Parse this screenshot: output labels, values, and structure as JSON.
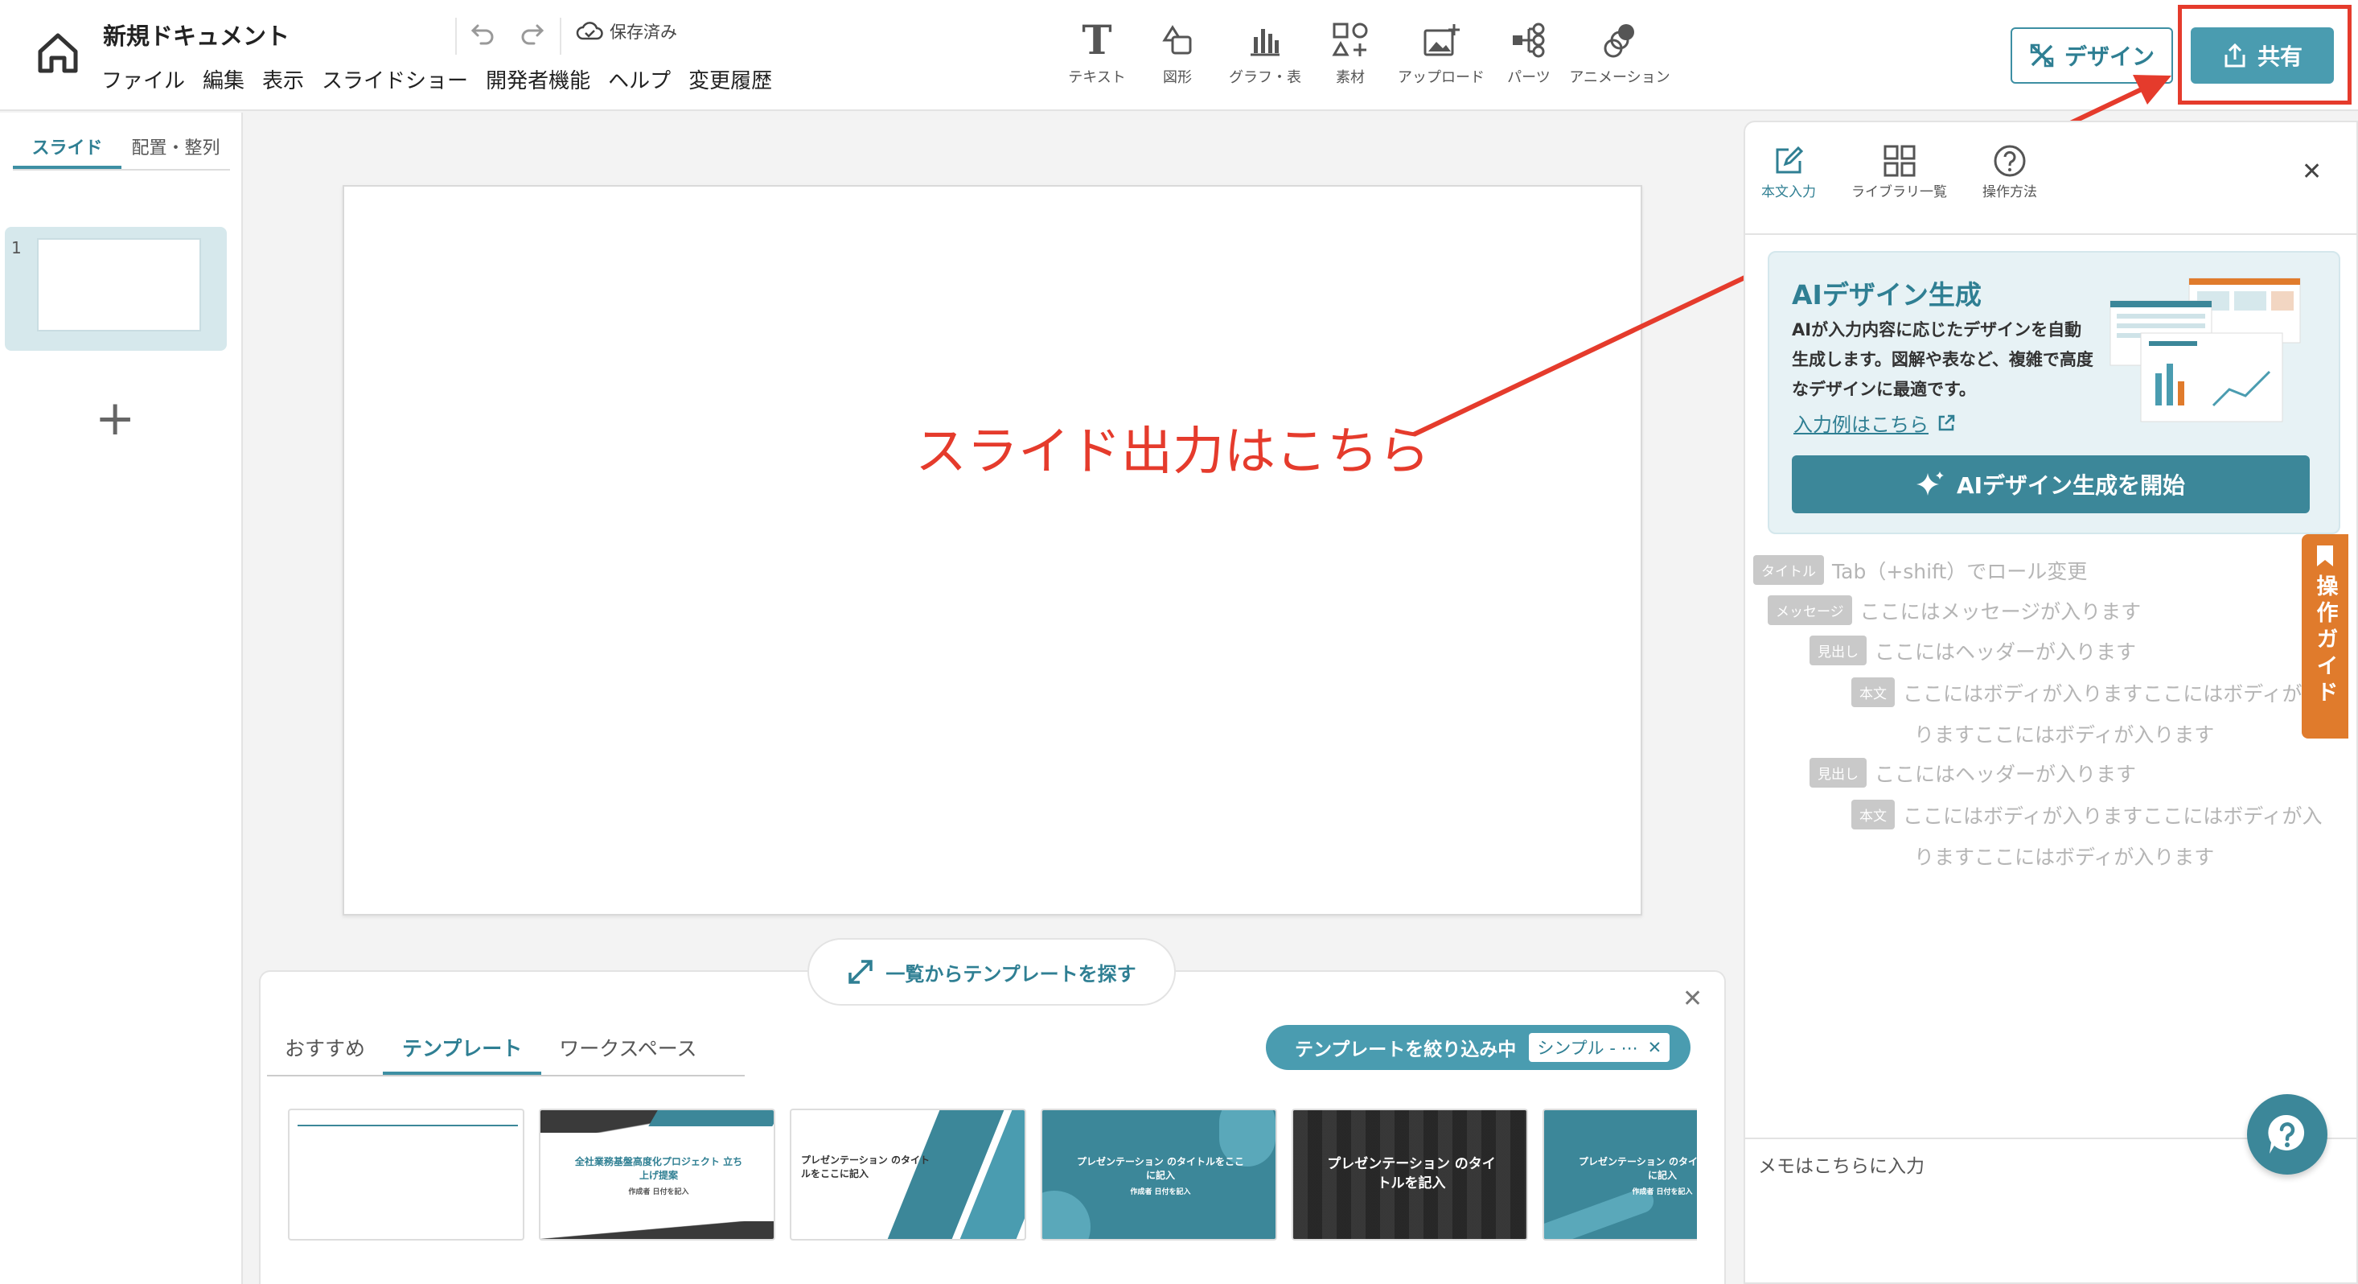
{
  "header": {
    "doc_title": "新規ドキュメント",
    "menu": [
      "ファイル",
      "編集",
      "表示",
      "スライドショー",
      "開発者機能",
      "ヘルプ",
      "変更履歴"
    ],
    "save_status": "保存済み",
    "tools": [
      "テキスト",
      "図形",
      "グラフ・表",
      "素材",
      "アップロード",
      "パーツ",
      "アニメーション"
    ],
    "design_label": "デザイン",
    "share_label": "共有"
  },
  "left_panel": {
    "tabs": [
      "スライド",
      "配置・整列"
    ],
    "slides": [
      {
        "number": "1"
      }
    ],
    "add_symbol": "+"
  },
  "canvas": {
    "annotation": "スライド出力はこちら",
    "annotation_color": "#e53b2c"
  },
  "template_drawer": {
    "find_button": "一覧からテンプレートを探す",
    "tabs": [
      "おすすめ",
      "テンプレート",
      "ワークスペース"
    ],
    "active_tab": "テンプレート",
    "filter_label": "テンプレートを絞り込み中",
    "filter_chip": "シンプル - ⋯",
    "templates": [
      {
        "title": ""
      },
      {
        "title": "全社業務基盤高度化プロジェクト 立ち上げ提案",
        "sub": "作成者 日付を記入"
      },
      {
        "title": "プレゼンテーション のタイトルをここに記入"
      },
      {
        "title": "プレゼンテーション のタイトルをここに記入",
        "sub": "作成者 日付を記入"
      },
      {
        "title": "プレゼンテーション のタイトルを記入"
      },
      {
        "title": "プレゼンテーション のタイトルをここに記入",
        "sub": "作成者 日付を記入"
      }
    ]
  },
  "right_panel": {
    "tabs": [
      "本文入力",
      "ライブラリ一覧",
      "操作方法"
    ],
    "ai_card": {
      "title": "AIデザイン生成",
      "description": "AIが入力内容に応じたデザインを自動生成します。図解や表など、複雑で高度なデザインに最適です。",
      "link": "入力例はこちら",
      "button": "AIデザイン生成を開始"
    },
    "outline": [
      {
        "role": "タイトル",
        "text": "Tab（+shift）でロール変更"
      },
      {
        "role": "メッセージ",
        "text": "ここにはメッセージが入ります"
      },
      {
        "role": "見出し",
        "text": "ここにはヘッダーが入ります"
      },
      {
        "role": "本文",
        "text": "ここにはボディが入りますここにはボディが入",
        "cont": "りますここにはボディが入ります"
      },
      {
        "role": "見出し",
        "text": "ここにはヘッダーが入ります"
      },
      {
        "role": "本文",
        "text": "ここにはボディが入りますここにはボディが入",
        "cont": "りますここにはボディが入ります"
      }
    ],
    "guide_tab": "操作ガイド",
    "memo_placeholder": "メモはこちらに入力"
  },
  "colors": {
    "accent": "#3d8fa3",
    "accent_dark": "#2f7f93",
    "highlight_red": "#e53b2c",
    "guide_orange": "#e07b2c"
  }
}
